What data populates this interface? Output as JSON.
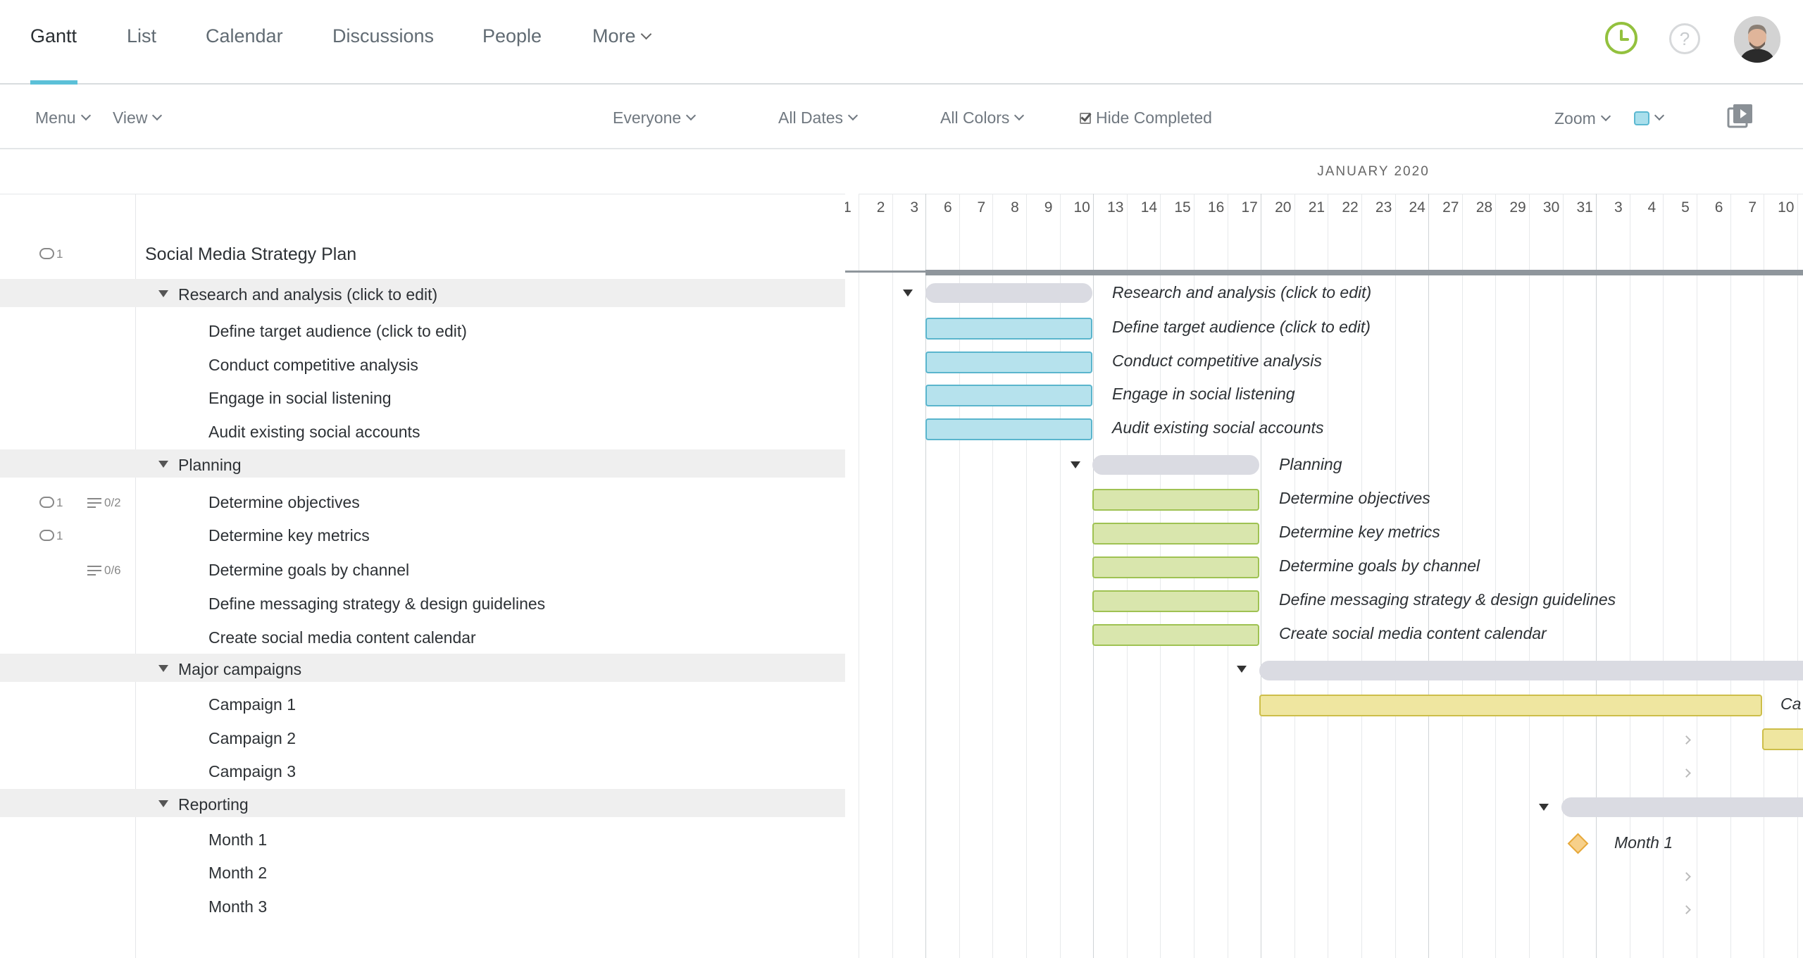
{
  "nav": {
    "tabs": [
      {
        "label": "Gantt",
        "active": true
      },
      {
        "label": "List"
      },
      {
        "label": "Calendar"
      },
      {
        "label": "Discussions"
      },
      {
        "label": "People"
      },
      {
        "label": "More"
      }
    ],
    "help_label": "?"
  },
  "toolbar": {
    "menu": "Menu",
    "view": "View",
    "everyone": "Everyone",
    "all_dates": "All Dates",
    "all_colors": "All Colors",
    "hide_completed": "Hide Completed",
    "zoom": "Zoom"
  },
  "gantt": {
    "month": "JANUARY 2020",
    "dates": [
      "1",
      "2",
      "3",
      "6",
      "7",
      "8",
      "9",
      "10",
      "13",
      "14",
      "15",
      "16",
      "17",
      "20",
      "21",
      "22",
      "23",
      "24",
      "27",
      "28",
      "29",
      "30",
      "31",
      "3",
      "4",
      "5",
      "6",
      "7",
      "10"
    ]
  },
  "project": {
    "title": "Social Media Strategy Plan",
    "comments": "1"
  },
  "tasks": [
    {
      "name": "Research and analysis (click to edit)",
      "group": true,
      "bar_label": "Research and analysis (click to edit)"
    },
    {
      "name": "Define target audience (click to edit)",
      "bar_label": "Define target audience (click to edit)"
    },
    {
      "name": "Conduct competitive analysis",
      "bar_label": "Conduct competitive analysis"
    },
    {
      "name": "Engage in social listening",
      "bar_label": "Engage in social listening"
    },
    {
      "name": "Audit existing social accounts",
      "bar_label": "Audit existing social accounts"
    },
    {
      "name": "Planning",
      "group": true,
      "bar_label": "Planning"
    },
    {
      "name": "Determine objectives",
      "comments": "1",
      "checklist": "0/2",
      "bar_label": "Determine objectives"
    },
    {
      "name": "Determine key metrics",
      "comments": "1",
      "bar_label": "Determine key metrics"
    },
    {
      "name": "Determine goals by channel",
      "checklist": "0/6",
      "bar_label": "Determine goals by channel"
    },
    {
      "name": "Define messaging strategy & design guidelines",
      "bar_label": "Define messaging strategy & design guidelines"
    },
    {
      "name": "Create social media content calendar",
      "bar_label": "Create social media content calendar"
    },
    {
      "name": "Major campaigns",
      "group": true
    },
    {
      "name": "Campaign 1",
      "bar_label": "Ca"
    },
    {
      "name": "Campaign 2"
    },
    {
      "name": "Campaign 3"
    },
    {
      "name": "Reporting",
      "group": true
    },
    {
      "name": "Month 1",
      "bar_label": "Month 1"
    },
    {
      "name": "Month 2"
    },
    {
      "name": "Month 3"
    }
  ],
  "colors": {
    "accent": "#5bc0d8",
    "blue_bar": "#b6e2ed",
    "green_bar": "#d9e6ad",
    "yellow_bar": "#efe6a0",
    "group_bar": "#dadbe2",
    "milestone": "#f7d08a"
  }
}
